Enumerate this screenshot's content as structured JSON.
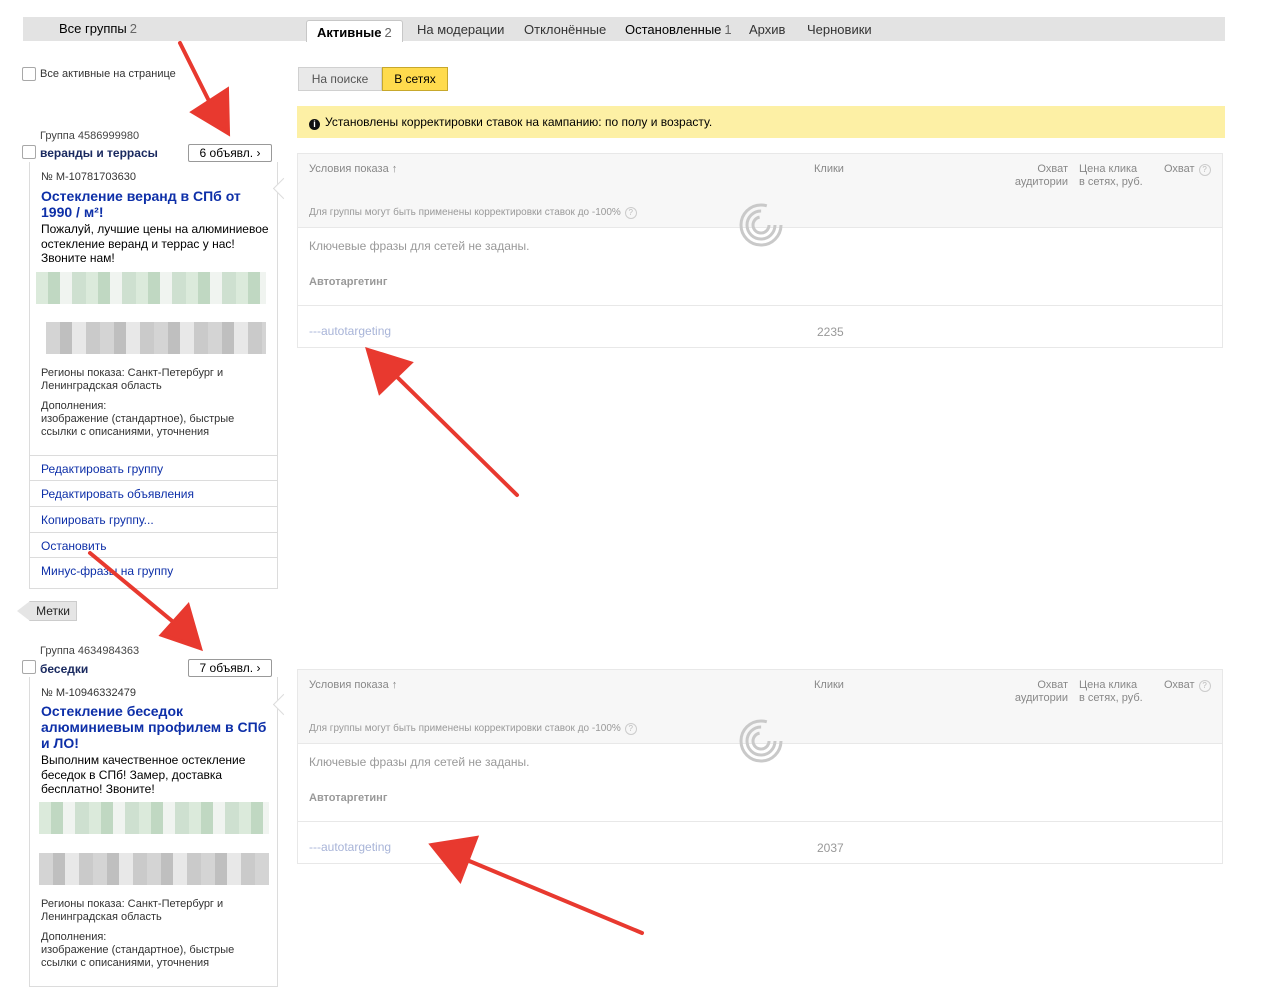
{
  "top_tabs": {
    "all_groups": {
      "label": "Все группы",
      "count": "2"
    },
    "tabs": [
      {
        "label": "Активные",
        "count": "2"
      },
      {
        "label": "На модерации",
        "count": ""
      },
      {
        "label": "Отклонённые",
        "count": ""
      },
      {
        "label": "Остановленные",
        "count": "1"
      },
      {
        "label": "Архив",
        "count": ""
      },
      {
        "label": "Черновики",
        "count": ""
      }
    ]
  },
  "select_all_label": "Все активные на странице",
  "groups": [
    {
      "id_label": "Группа 4586999980",
      "name": "веранды и террасы",
      "ads_button": "6 объявл.",
      "ad_number": "№ М-10781703630",
      "ad_title": "Остекление веранд в СПб от 1990 / м²!",
      "ad_text": "Пожалуй, лучшие цены на алюминиевое остекление веранд и террас у нас! Звоните нам!",
      "regions": "Регионы показа: Санкт-Петербург и Ленинградская область",
      "extras_label": "Дополнения:",
      "extras": "изображение (стандартное), быстрые ссылки с описаниями, уточнения",
      "actions": [
        "Редактировать группу",
        "Редактировать объявления",
        "Копировать группу...",
        "Остановить",
        "Минус-фразы на группу"
      ]
    },
    {
      "id_label": "Группа 4634984363",
      "name": "беседки",
      "ads_button": "7 объявл.",
      "ad_number": "№ М-10946332479",
      "ad_title": "Остекление беседок алюминиевым профилем в СПб и ЛО!",
      "ad_text": "Выполним качественное остекление беседок в СПб! Замер, доставка бесплатно! Звоните!",
      "regions": "Регионы показа: Санкт-Петербург и Ленинградская область",
      "extras_label": "Дополнения:",
      "extras": "изображение (стандартное), быстрые ссылки с описаниями, уточнения"
    }
  ],
  "labels_button": "Метки",
  "segment": {
    "search": "На поиске",
    "networks": "В сетях",
    "selected": "networks"
  },
  "notice": "Установлены корректировки ставок на кампанию: по полу и возрасту.",
  "table_headers": {
    "conditions": "Условия показа",
    "sort_arrow": "↑",
    "clicks": "Клики",
    "reach_audience": [
      "Охват",
      "аудитории"
    ],
    "price": [
      "Цена клика",
      "в сетях, руб."
    ],
    "reach": "Охват"
  },
  "tables": [
    {
      "note": "Для группы могут быть применены корректировки ставок до -100%",
      "empty_text": "Ключевые фразы для сетей не заданы.",
      "section": "Автотаргетинг",
      "row_link": "---autotargeting",
      "row_clicks": "2235"
    },
    {
      "note": "Для группы могут быть применены корректировки ставок до -100%",
      "empty_text": "Ключевые фразы для сетей не заданы.",
      "section": "Автотаргетинг",
      "row_link": "---autotargeting",
      "row_clicks": "2037"
    }
  ],
  "colors": {
    "accent_yellow": "#ffdb4d",
    "notice_bg": "#fdf0a5",
    "link_blue": "#0d2fa8",
    "arrow_red": "#e8392f"
  },
  "icons": {
    "info": "info-icon",
    "help": "question-icon",
    "spinner": "loading-spinner-icon",
    "chevron": "chevron-right-icon"
  }
}
